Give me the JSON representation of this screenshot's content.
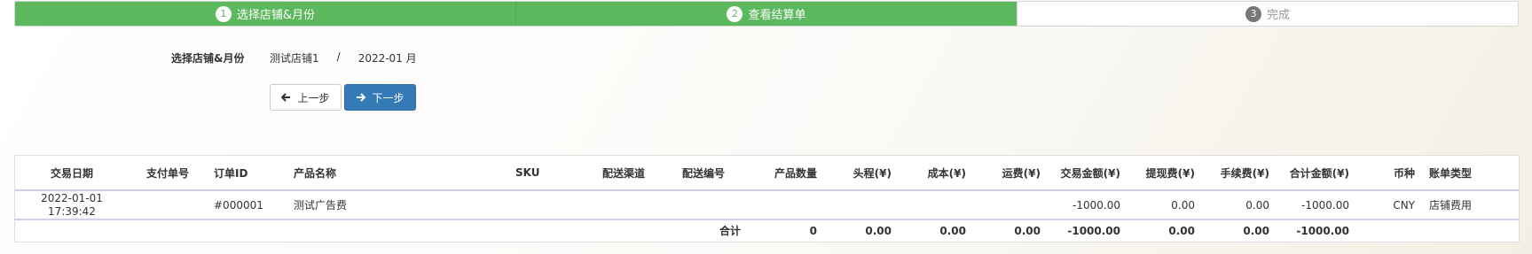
{
  "wizard": {
    "steps": [
      {
        "num": "1",
        "label": "选择店铺&月份"
      },
      {
        "num": "2",
        "label": "查看结算单"
      },
      {
        "num": "3",
        "label": "完成"
      }
    ]
  },
  "info": {
    "label": "选择店铺&月份",
    "store": "测试店铺1",
    "separator": "/",
    "month": "2022-01 月"
  },
  "buttons": {
    "prev": "上一步",
    "next": "下一步"
  },
  "colors": {
    "step_done": "#5cb85c",
    "primary": "#337ab7"
  },
  "table": {
    "headers": [
      "交易日期",
      "支付单号",
      "订单ID",
      "产品名称",
      "SKU",
      "配送渠道",
      "配送编号",
      "产品数量",
      "头程(¥)",
      "成本(¥)",
      "运费(¥)",
      "交易金额(¥)",
      "提现费(¥)",
      "手续费(¥)",
      "合计金额(¥)",
      "币种",
      "账单类型"
    ],
    "rows": [
      {
        "date_line1": "2022-01-01",
        "date_line2": "17:39:42",
        "payment_no": "",
        "order_id": "#000001",
        "product_name": "测试广告费",
        "sku": "",
        "channel": "",
        "delivery_no": "",
        "qty": "",
        "first_leg": "",
        "cost": "",
        "freight": "",
        "trade_amount": "-1000.00",
        "withdraw_fee": "0.00",
        "service_fee": "0.00",
        "total": "-1000.00",
        "currency": "CNY",
        "bill_type": "店铺费用"
      }
    ],
    "summary": {
      "label": "合计",
      "qty": "0",
      "first_leg": "0.00",
      "cost": "0.00",
      "freight": "0.00",
      "trade_amount": "-1000.00",
      "withdraw_fee": "0.00",
      "service_fee": "0.00",
      "total": "-1000.00"
    }
  }
}
